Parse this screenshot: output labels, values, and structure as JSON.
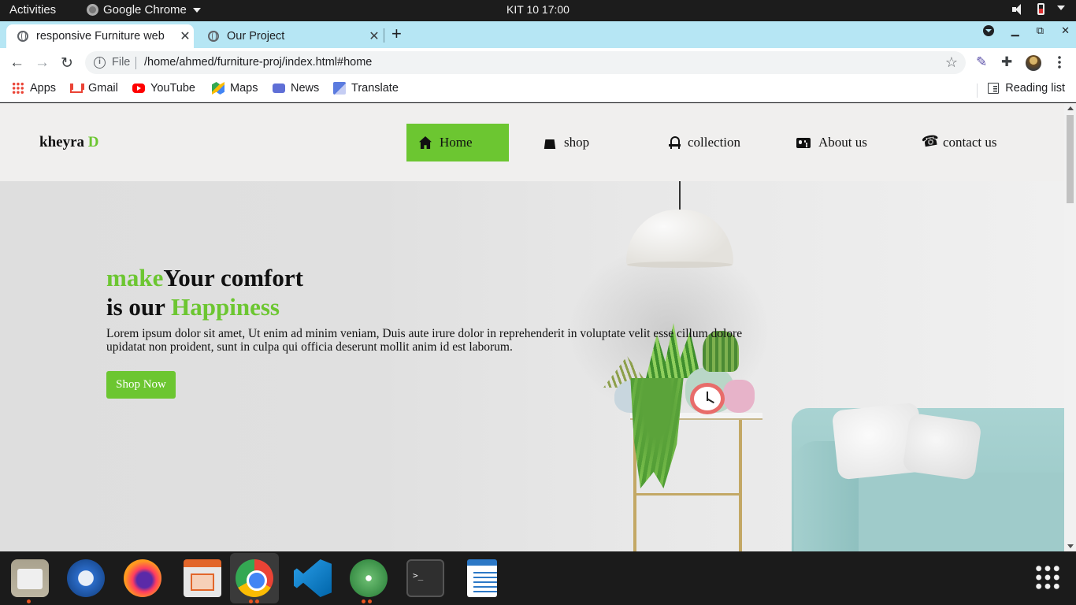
{
  "system_bar": {
    "activities": "Activities",
    "app_name": "Google Chrome",
    "clock": "KIT 10  17:00"
  },
  "browser": {
    "tabs": [
      {
        "title": "responsive Furniture web",
        "active": true
      },
      {
        "title": "Our Project",
        "active": false
      }
    ],
    "address": {
      "scheme": "File",
      "url": "/home/ahmed/furniture-proj/index.html#home"
    },
    "bookmarks": [
      {
        "label": "Apps",
        "icon": "apps-grid-icon"
      },
      {
        "label": "Gmail",
        "icon": "gmail-icon"
      },
      {
        "label": "YouTube",
        "icon": "youtube-icon"
      },
      {
        "label": "Maps",
        "icon": "maps-icon"
      },
      {
        "label": "News",
        "icon": "news-icon"
      },
      {
        "label": "Translate",
        "icon": "translate-icon"
      }
    ],
    "reading_list": "Reading list"
  },
  "site": {
    "logo": {
      "text": "kheyra ",
      "accent": "D"
    },
    "nav": [
      {
        "label": "Home",
        "icon": "home-icon",
        "active": true
      },
      {
        "label": "shop",
        "icon": "shopping-bag-icon",
        "active": false
      },
      {
        "label": "collection",
        "icon": "chair-icon",
        "active": false
      },
      {
        "label": "About us",
        "icon": "id-card-icon",
        "active": false
      },
      {
        "label": "contact us",
        "icon": "phone-icon",
        "active": false
      }
    ],
    "hero": {
      "line1_green": "make",
      "line1_dark": "Your comfort",
      "line2_dark": "is our ",
      "line2_green": "Happiness",
      "paragraph_line1": "Lorem ipsum dolor sit amet, Ut enim ad minim veniam, Duis aute irure dolor in reprehenderit in voluptate velit esse cillum dolore",
      "paragraph_line2": "upidatat non proident, sunt in culpa qui officia deserunt mollit anim id est laborum.",
      "button": "Shop Now"
    },
    "colors": {
      "accent": "#6cc631",
      "header_bg": "#f0efee"
    }
  },
  "dock": {
    "apps": [
      {
        "name": "files",
        "running": true
      },
      {
        "name": "thunderbird",
        "running": false
      },
      {
        "name": "firefox",
        "running": false
      },
      {
        "name": "libreoffice-impress",
        "running": false
      },
      {
        "name": "google-chrome",
        "running": true
      },
      {
        "name": "vs-code",
        "running": false
      },
      {
        "name": "atom",
        "running": true
      },
      {
        "name": "terminal",
        "running": false
      },
      {
        "name": "libreoffice-writer",
        "running": false
      }
    ],
    "terminal_glyph": ">_"
  }
}
